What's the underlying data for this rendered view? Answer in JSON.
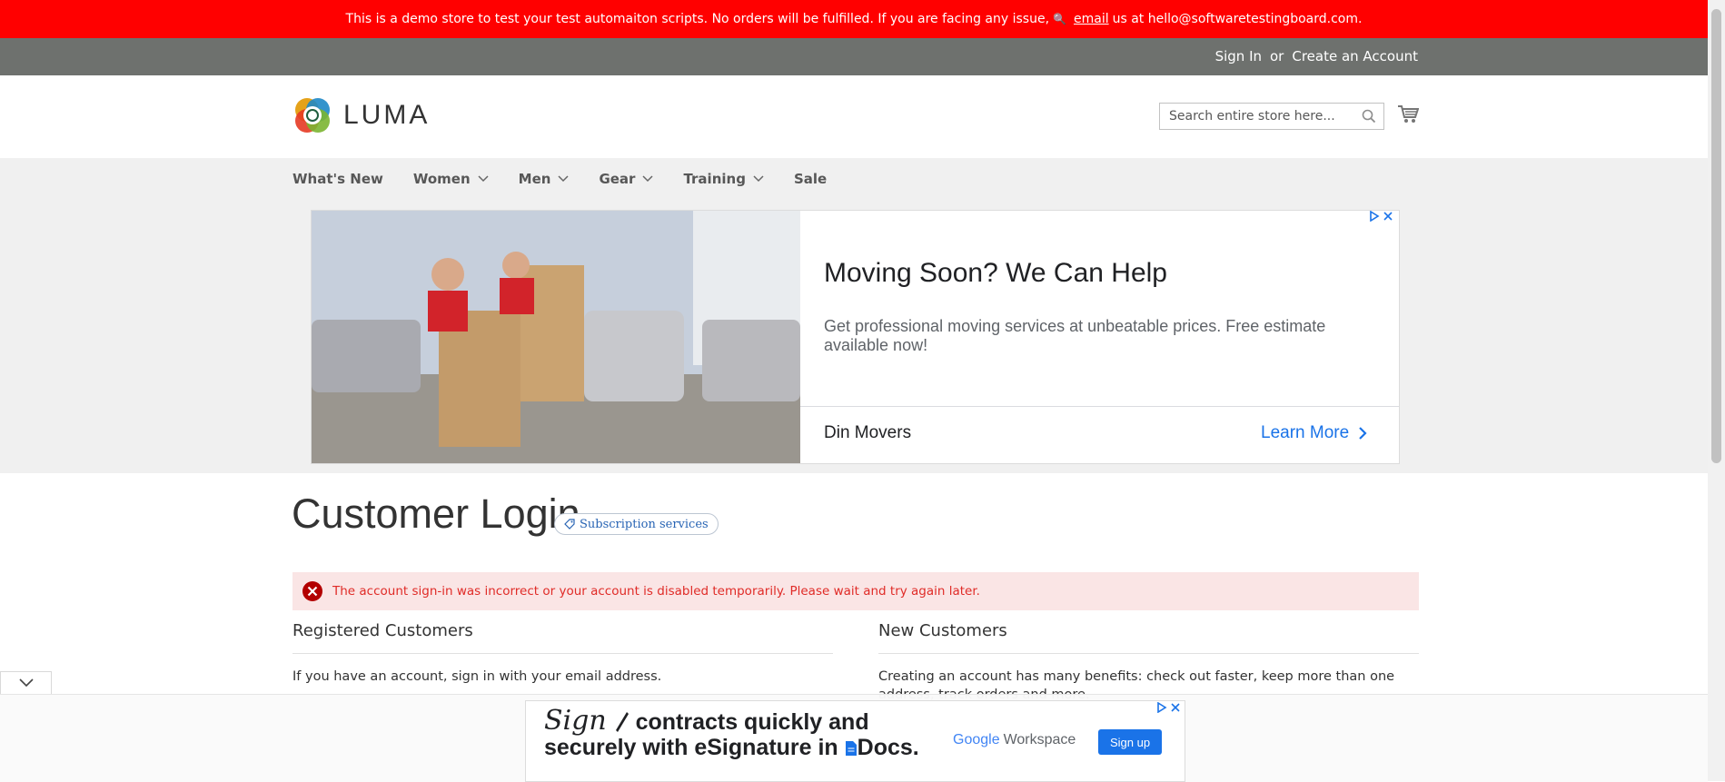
{
  "notice": {
    "text_before": "This is a demo store to test your test automaiton scripts. No orders will be fulfilled. If you are facing any issue,",
    "email_link": "email",
    "text_after": "us at hello@softwaretestingboard.com."
  },
  "account": {
    "sign_in": "Sign In",
    "or": "or",
    "create": "Create an Account"
  },
  "header": {
    "logo_text": "LUMA",
    "search_placeholder": "Search entire store here..."
  },
  "nav": {
    "items": [
      {
        "label": "What's New",
        "has_submenu": false
      },
      {
        "label": "Women",
        "has_submenu": true
      },
      {
        "label": "Men",
        "has_submenu": true
      },
      {
        "label": "Gear",
        "has_submenu": true
      },
      {
        "label": "Training",
        "has_submenu": true
      },
      {
        "label": "Sale",
        "has_submenu": false
      }
    ]
  },
  "ad": {
    "title": "Moving Soon? We Can Help",
    "description": "Get professional moving services at unbeatable prices. Free estimate available now!",
    "advertiser": "Din Movers",
    "cta": "Learn More"
  },
  "page": {
    "title": "Customer Login",
    "badge": "Subscription services",
    "error": "The account sign-in was incorrect or your account is disabled temporarily. Please wait and try again later."
  },
  "registered": {
    "title": "Registered Customers",
    "text": "If you have an account, sign in with your email address."
  },
  "new_customers": {
    "title": "New Customers",
    "text": "Creating an account has many benefits: check out faster, keep more than one address, track orders and more."
  },
  "bottom_ad": {
    "script_word": "Sign",
    "line1": "contracts quickly and",
    "line2": "securely with eSignature in",
    "docs": "Docs.",
    "brand_google": "Google",
    "brand_workspace": "Workspace",
    "cta": "Sign up"
  },
  "colors": {
    "notice_bg": "#ff0000",
    "account_bar_bg": "#6e716e",
    "nav_bg": "#f0f0f0",
    "error_bg": "#fae5e5",
    "error_text": "#e02b27",
    "ad_link": "#1a73e8"
  }
}
